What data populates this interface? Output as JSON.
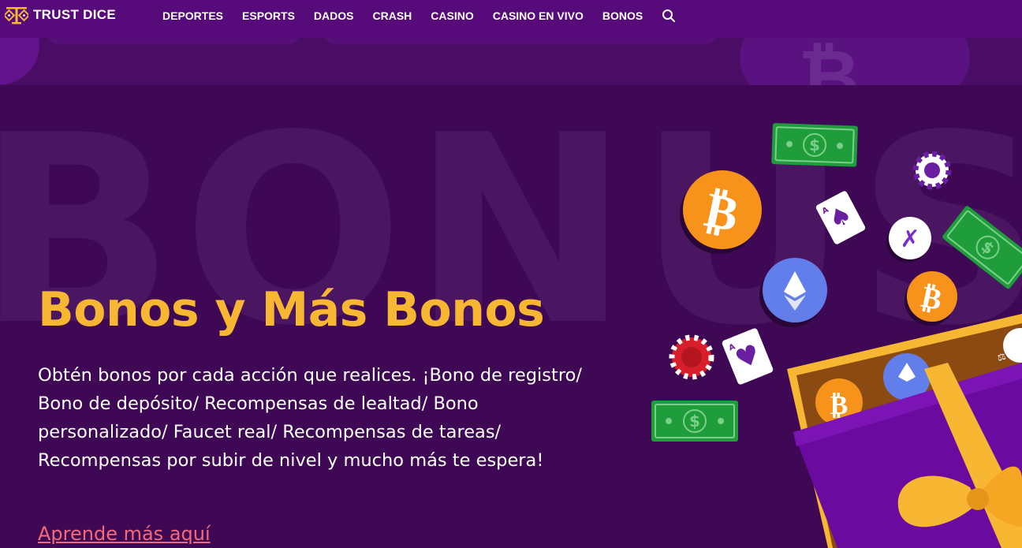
{
  "header": {
    "brand": "TRUST DICE",
    "nav": [
      "DEPORTES",
      "ESPORTS",
      "DADOS",
      "CRASH",
      "CASINO",
      "CASINO EN VIVO",
      "BONOS"
    ],
    "search_icon": "search-icon"
  },
  "hero": {
    "watermark": "BONUS",
    "title": "Bonos y Más Bonos",
    "description": "Obtén bonos por cada acción que realices. ¡Bono de registro/ Bono de depósito/ Recompensas de lealtad/ Bono personalizado/ Faucet real/ Recompensas de tareas/ Recompensas por subir de nivel y mucho más te espera!",
    "link": "Aprende más aquí"
  },
  "colors": {
    "header_bg": "#570a7a",
    "hero_bg": "#3e0854",
    "title": "#f7b733",
    "link": "#f36a7b",
    "bitcoin": "#f7931a",
    "ethereum": "#627eea",
    "cash": "#1f9d3a"
  },
  "art_icons": [
    "dollar-bill-icon",
    "bitcoin-coin-icon",
    "ethereum-coin-icon",
    "poker-chip-icon",
    "ace-of-spades-card-icon",
    "ace-of-hearts-card-icon",
    "x-token-icon",
    "gift-box-icon"
  ]
}
